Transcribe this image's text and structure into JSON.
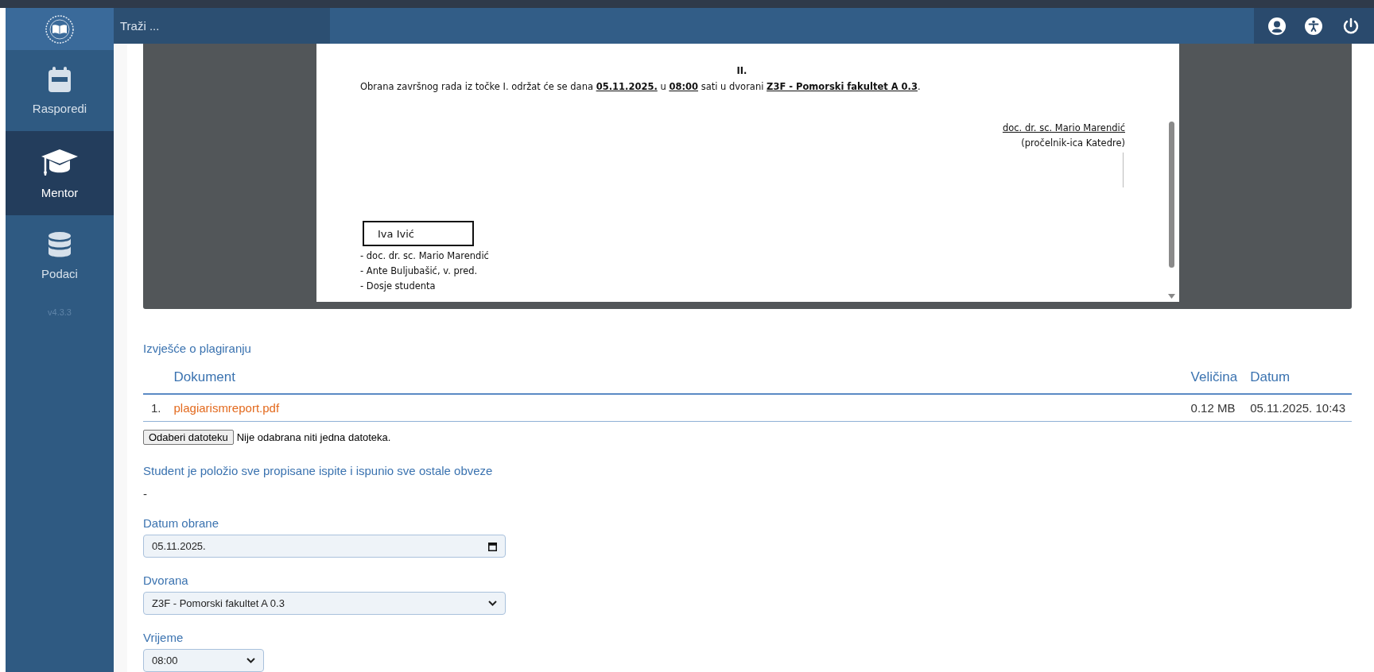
{
  "header": {
    "search_placeholder": "Traži ..."
  },
  "sidebar": {
    "items": [
      {
        "kind": "calendar",
        "label": "Rasporedi",
        "selected": false
      },
      {
        "kind": "mentor",
        "label": "Mentor",
        "selected": true
      },
      {
        "kind": "database",
        "label": "Podaci",
        "selected": false
      }
    ],
    "version": "v4.3.3"
  },
  "document_viewer": {
    "heading": "II.",
    "paragraph": "Obrana završnog rada iz točke I. održat će se dana **05.11.2025.** u **08:00** sati u dvorani **Z3F - Pomorski fakultet A 0.3**.",
    "signature_name": "doc. dr. sc. Mario Marendić",
    "signature_role": "(pročelnik-ica Katedre)",
    "recipient_box": "Iva Ivić",
    "recipients": [
      "- doc. dr. sc. Mario Marendić",
      "- Ante Buljubašić, v. pred.",
      "- Dosje studenta"
    ]
  },
  "plagiarism_report": {
    "title": "Izvješće o plagiranju",
    "columns": [
      "Dokument",
      "Veličina",
      "Datum"
    ],
    "rows": [
      {
        "number": "1.",
        "document": "plagiarismreport.pdf",
        "size": "0.12 MB",
        "date": "05.11.2025. 10:43"
      }
    ]
  },
  "file_upload": {
    "button": "Odaberi datoteku",
    "status": "Nije odabrana niti jedna datoteka."
  },
  "obligations": {
    "label": "Student je položio sve propisane ispite i ispunio sve ostale obveze",
    "value": "-"
  },
  "fields": [
    {
      "kind": "date",
      "label": "Datum obrane",
      "value": "05.11.2025."
    },
    {
      "kind": "select",
      "label": "Dvorana",
      "value": "Z3F - Pomorski fakultet A 0.3"
    },
    {
      "kind": "select",
      "label": "Vrijeme",
      "value": "08:00"
    }
  ]
}
